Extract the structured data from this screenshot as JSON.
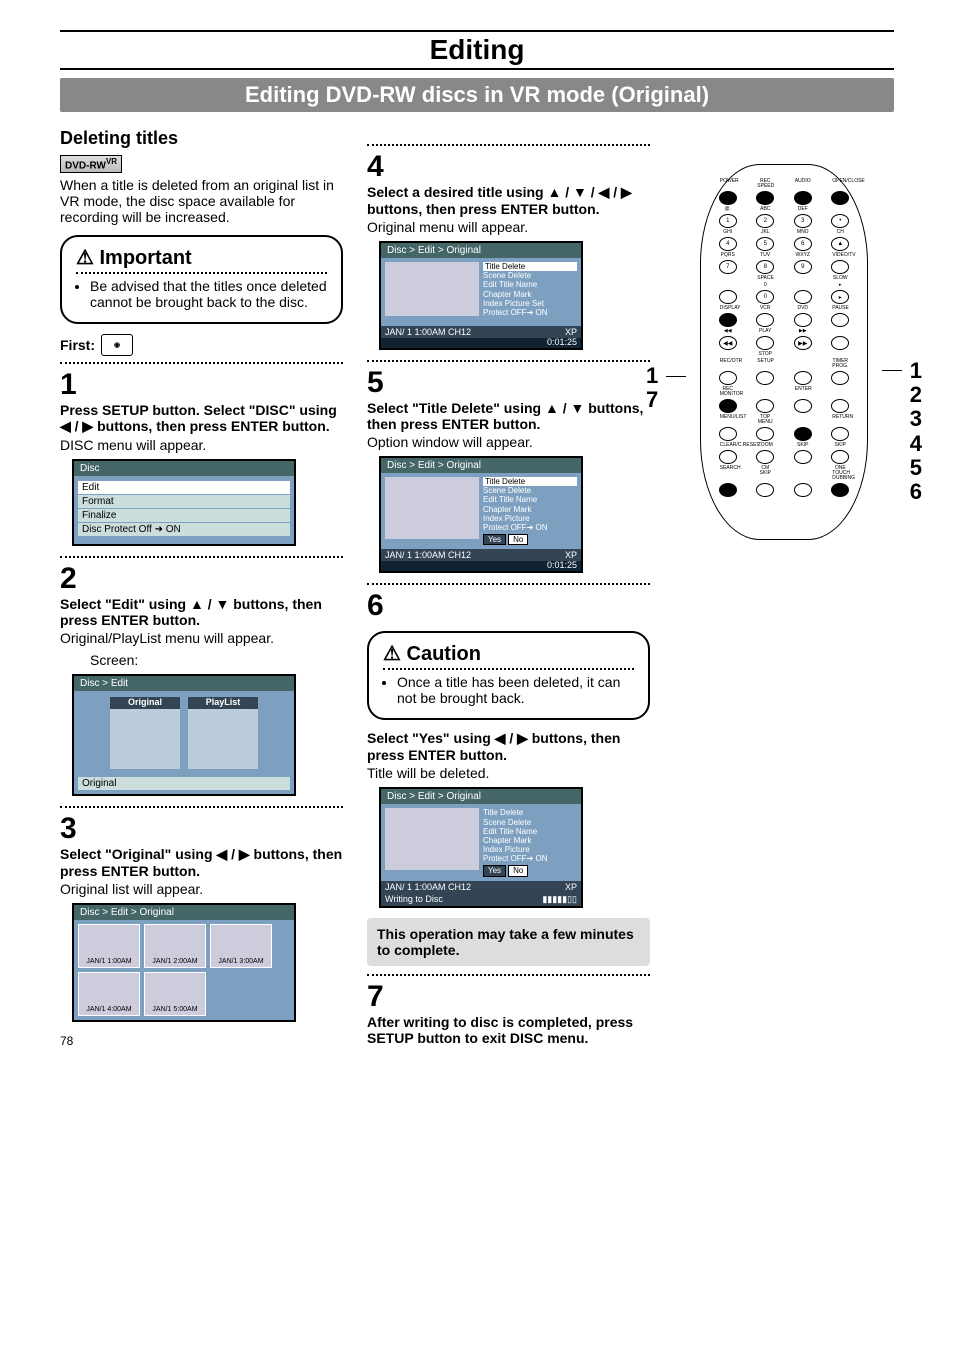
{
  "page_title": "Editing",
  "sub_title": "Editing DVD-RW discs in VR mode (Original)",
  "section_heading": "Deleting titles",
  "dvd_badge": "DVD-RW",
  "dvd_badge_sup": "VR",
  "intro": "When a title is deleted from an original list in VR mode, the disc space available for recording will be increased.",
  "important": {
    "title": "Important",
    "bullet": "Be advised that the titles once deleted cannot be brought back to the disc."
  },
  "first_label": "First:",
  "steps": {
    "s1": {
      "num": "1",
      "instr": "Press SETUP button. Select \"DISC\" using ◀ / ▶ buttons, then press ENTER button.",
      "desc": "DISC menu will appear."
    },
    "s2": {
      "num": "2",
      "instr": "Select \"Edit\" using ▲ / ▼ buttons, then press ENTER button.",
      "desc": "Original/PlayList menu will appear.",
      "screen_label": "Screen:"
    },
    "s3": {
      "num": "3",
      "instr": "Select \"Original\" using ◀ / ▶ buttons, then press ENTER button.",
      "desc": "Original list will appear."
    },
    "s4": {
      "num": "4",
      "instr": "Select a desired title using ▲ / ▼ / ◀ / ▶ buttons, then press ENTER button.",
      "desc": "Original menu will appear."
    },
    "s5": {
      "num": "5",
      "instr": "Select \"Title Delete\" using ▲ / ▼ buttons, then press ENTER button.",
      "desc": "Option window will appear."
    },
    "s6": {
      "num": "6",
      "instr": "Select \"Yes\" using ◀ / ▶ buttons, then press ENTER button.",
      "desc": "Title will be deleted."
    },
    "s7": {
      "num": "7",
      "instr": "After writing to disc is completed, press SETUP button to exit DISC menu."
    }
  },
  "caution": {
    "title": "Caution",
    "bullet": "Once a title has been deleted, it can not be brought back."
  },
  "gray_note": "This operation may take a few minutes to complete.",
  "menu1": {
    "hdr": "Disc",
    "items": [
      "Edit",
      "Format",
      "Finalize",
      "Disc Protect Off ➜ ON"
    ]
  },
  "menu2": {
    "hdr": "Disc > Edit",
    "left": "Original",
    "right": "PlayList",
    "footer": "Original"
  },
  "menu3": {
    "hdr": "Disc > Edit > Original",
    "thumbs": [
      "JAN/1  1:00AM",
      "JAN/1  2:00AM",
      "JAN/1  3:00AM",
      "JAN/1  4:00AM",
      "JAN/1  5:00AM"
    ]
  },
  "menu4": {
    "hdr": "Disc > Edit > Original",
    "items": [
      "Title Delete",
      "Scene Delete",
      "Edit Title Name",
      "Chapter Mark",
      "Index Picture Set",
      "Protect OFF➜ ON"
    ],
    "status_l": "JAN/ 1   1:00AM  CH12",
    "status_r": "XP",
    "time": "0:01:25"
  },
  "menu5": {
    "hdr": "Disc > Edit > Original",
    "items": [
      "Title Delete",
      "Scene Delete",
      "Edit Title Name",
      "Chapter Mark",
      "Index Picture",
      "Protect OFF➜ ON"
    ],
    "yes": "Yes",
    "no": "No",
    "status_l": "JAN/ 1   1:00AM  CH12",
    "status_r": "XP",
    "time": "0:01:25"
  },
  "menu6": {
    "hdr": "Disc > Edit > Original",
    "items": [
      "Title Delete",
      "Scene Delete",
      "Edit Title Name",
      "Chapter Mark",
      "Index Picture",
      "Protect OFF➜ ON"
    ],
    "yes": "Yes",
    "no": "No",
    "status_l": "JAN/ 1   1:00AM  CH12",
    "status_r": "XP",
    "writing": "Writing to Disc"
  },
  "remote": {
    "side_l": [
      "1",
      "7"
    ],
    "side_r": [
      "1",
      "2",
      "3",
      "4",
      "5",
      "6"
    ],
    "row_labels": [
      [
        "POWER",
        "REC SPEED",
        "AUDIO",
        "OPEN/CLOSE"
      ],
      [
        "@.",
        "ABC",
        "DEF",
        ""
      ],
      [
        "1",
        "2",
        "3",
        "•"
      ],
      [
        "GHI",
        "JKL",
        "MNO",
        "CH"
      ],
      [
        "4",
        "5",
        "6",
        "▲"
      ],
      [
        "PQRS",
        "TUV",
        "WXYZ",
        "VIDEO/TV"
      ],
      [
        "7",
        "8",
        "9",
        ""
      ],
      [
        "",
        "SPACE",
        "",
        "SLOW"
      ],
      [
        "",
        "0",
        "",
        "▸"
      ],
      [
        "DISPLAY",
        "VCR",
        "DVD",
        "PAUSE"
      ],
      [
        "",
        "",
        "",
        ""
      ],
      [
        "◀◀",
        "PLAY",
        "▶▶",
        ""
      ],
      [
        "",
        "STOP",
        "",
        ""
      ],
      [
        "REC/OTR",
        "SETUP",
        "",
        "TIMER PROG."
      ],
      [
        "REC MONITOR",
        "",
        "ENTER",
        ""
      ],
      [
        "MENU/LIST",
        "TOP MENU",
        "",
        "RETURN"
      ],
      [
        "CLEAR/C.RESET",
        "ZOOM",
        "SKIP",
        "SKIP"
      ],
      [
        "SEARCH",
        "CM SKIP",
        "",
        "ONE TOUCH DUBBING"
      ]
    ]
  },
  "page_number": "78"
}
